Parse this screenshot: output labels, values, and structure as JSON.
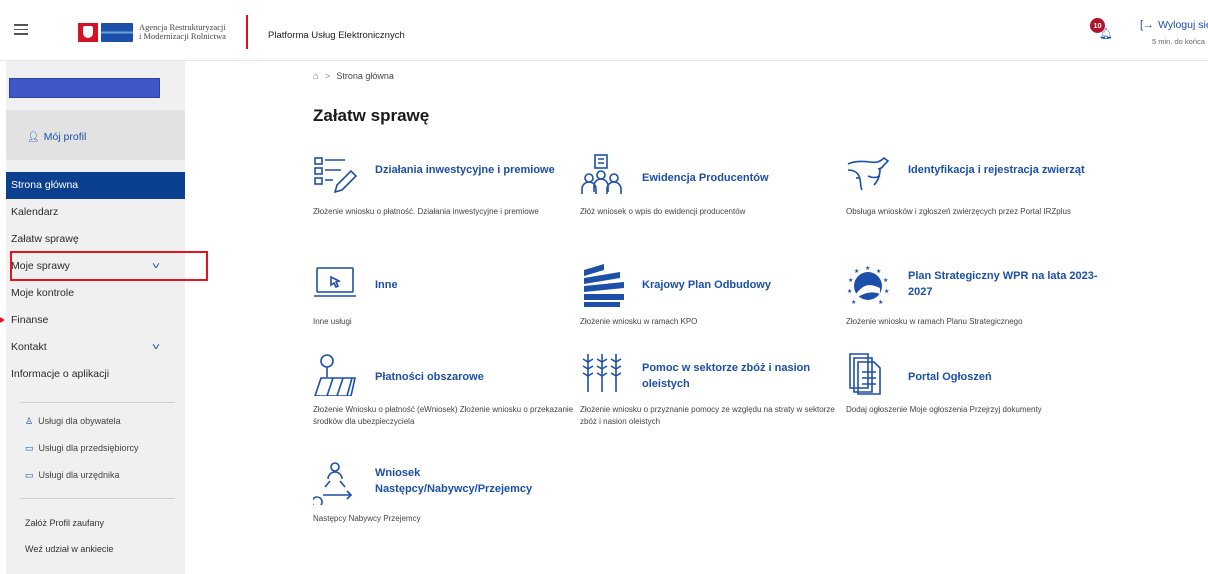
{
  "header": {
    "logo_line1": "Agencja Restrukturyzacji",
    "logo_line2": "i Modernizacji Rolnictwa",
    "platform_title": "Platforma Usług Elektronicznych",
    "notifications_count": "10",
    "logout_label": "Wyloguj się",
    "session_text": "5 min. do końca"
  },
  "sidebar": {
    "profile_label": "Mój profil",
    "nav": [
      {
        "label": "Strona główna",
        "active": true
      },
      {
        "label": "Kalendarz"
      },
      {
        "label": "Załatw sprawę"
      },
      {
        "label": "Moje sprawy",
        "expandable": true
      },
      {
        "label": "Moje kontrole"
      },
      {
        "label": "Finanse"
      },
      {
        "label": "Kontakt",
        "expandable": true
      },
      {
        "label": "Informacje o aplikacji"
      }
    ],
    "services": [
      {
        "label": "Usługi dla obywatela",
        "icon": "person-icon"
      },
      {
        "label": "Usługi dla przedsiębiorcy",
        "icon": "briefcase-icon"
      },
      {
        "label": "Usługi dla urzędnika",
        "icon": "monitor-icon"
      }
    ],
    "extras": [
      "Załóż Profil zaufany",
      "Weź udział w ankiecie"
    ]
  },
  "breadcrumb": {
    "home_icon": "home-icon",
    "current": "Strona główna"
  },
  "main": {
    "title": "Załatw sprawę",
    "tiles": [
      {
        "title": "Działania inwestycyjne i premiowe",
        "desc": "Złożenie wniosku o płatność. Działania inwestycyjne i premiowe",
        "icon": "form-pen-icon"
      },
      {
        "title": "Ewidencja Producentów",
        "desc": "Złóż wniosek o wpis do ewidencji producentów",
        "icon": "people-icon"
      },
      {
        "title": "Identyfikacja i rejestracja zwierząt",
        "desc": "Obsługa wniosków i zgłoszeń zwierzęcych przez Portal IRZplus",
        "icon": "cow-icon"
      },
      {
        "title": "Inne",
        "desc": "Inne usługi",
        "icon": "laptop-icon"
      },
      {
        "title": "Krajowy Plan Odbudowy",
        "desc": "Złożenie wniosku w ramach KPO",
        "icon": "kpo-icon"
      },
      {
        "title": "Plan Strategiczny WPR na lata 2023-2027",
        "desc": "Złożenie wniosku w ramach Planu Strategicznego",
        "icon": "eu-plan-icon"
      },
      {
        "title": "Płatności obszarowe",
        "desc": "Złożenie Wniosku o płatność (eWniosek) Złożenie wniosku o przekazanie środków dla ubezpieczyciela",
        "icon": "field-icon"
      },
      {
        "title": "Pomoc w sektorze zbóż i nasion oleistych",
        "desc": "Złożenie wniosku o przyznanie pomocy ze względu na straty w sektorze zbóż i nasion oleistych",
        "icon": "grain-icon"
      },
      {
        "title": "Portal Ogłoszeń",
        "desc": "Dodaj ogłoszenie Moje ogłoszenia Przejrzyj dokumenty",
        "icon": "documents-icon"
      },
      {
        "title": "Wniosek Następcy/Nabywcy/Przejemcy",
        "desc": "Następcy Nabywcy Przejemcy",
        "icon": "transfer-icon"
      }
    ]
  }
}
